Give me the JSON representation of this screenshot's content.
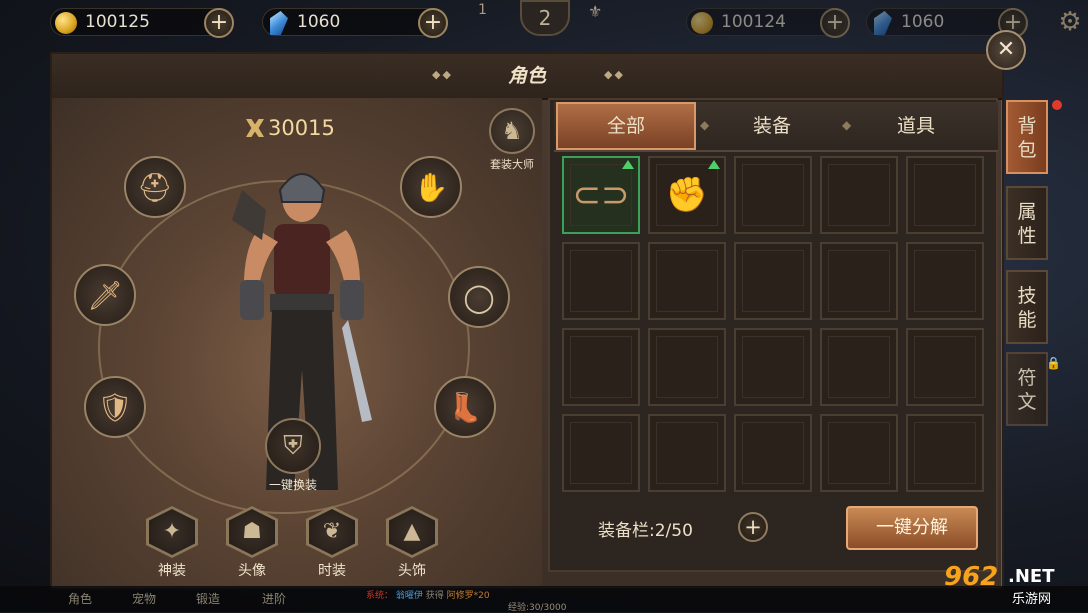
{
  "hud": {
    "gold": "100125",
    "gems": "1060",
    "gold_bg": "100124",
    "gems_bg": "1060",
    "level_left": "1",
    "level_center": "2",
    "plus": "+"
  },
  "panel": {
    "title": "角色",
    "close": "✕"
  },
  "character": {
    "power": "30015",
    "set_master_label": "套装大师",
    "one_click_wear_label": "一键换装",
    "equip_slots": [
      {
        "name": "helmet",
        "icon": "helmet-icon",
        "glyph": "⛑"
      },
      {
        "name": "weapon",
        "icon": "sword-icon",
        "glyph": "🗡"
      },
      {
        "name": "armor",
        "icon": "armor-icon",
        "glyph": "🛡"
      },
      {
        "name": "gloves",
        "icon": "gloves-icon",
        "glyph": "✋"
      },
      {
        "name": "ring",
        "icon": "ring-icon",
        "glyph": "◯"
      },
      {
        "name": "boots",
        "icon": "boots-icon",
        "glyph": "👢"
      }
    ],
    "bottom_buttons": [
      {
        "label": "神装",
        "icon": "divine-gear-icon"
      },
      {
        "label": "头像",
        "icon": "avatar-icon"
      },
      {
        "label": "时装",
        "icon": "fashion-icon"
      },
      {
        "label": "头饰",
        "icon": "headwear-icon"
      }
    ]
  },
  "inventory": {
    "tabs": [
      "全部",
      "装备",
      "道具"
    ],
    "active_tab": "全部",
    "items": [
      {
        "slot": 0,
        "icon": "belt-icon",
        "upgrade": true,
        "selected": true
      },
      {
        "slot": 1,
        "icon": "gauntlet-icon",
        "upgrade": true,
        "selected": false
      }
    ],
    "total_cells": 20,
    "capacity_text": "装备栏:2/50",
    "decompose_label": "一键分解"
  },
  "side_tabs": [
    {
      "label": "背包",
      "active": true
    },
    {
      "label": "属性",
      "active": false
    },
    {
      "label": "技能",
      "active": false
    },
    {
      "label": "符文",
      "active": false,
      "locked": true
    }
  ],
  "bottom_bar": {
    "nav": [
      "角色",
      "宠物",
      "锻造",
      "进阶"
    ],
    "system_prefix": "系统：",
    "player": "翁曜伊",
    "got": "获得",
    "reward": "阿修罗*20",
    "xp": "经验:30/3000"
  },
  "watermark": {
    "num": "962",
    "net": ".NET",
    "cn": "乐游网"
  },
  "colors": {
    "accent": "#b06e45",
    "upgrade_arrow": "#4fcf6a",
    "select_border": "#3aa05a"
  }
}
